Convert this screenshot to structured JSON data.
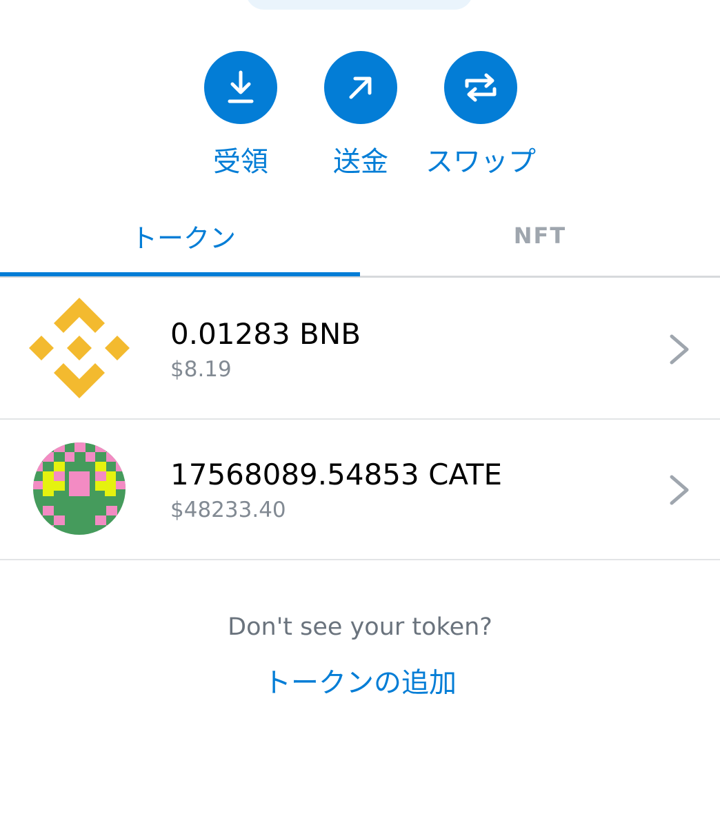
{
  "actions": {
    "receive_label": "受領",
    "send_label": "送金",
    "swap_label": "スワップ"
  },
  "tabs": {
    "tokens_label": "トークン",
    "nft_label": "NFT",
    "active": "tokens"
  },
  "tokens": [
    {
      "amount": "0.01283 BNB",
      "fiat": "$8.19",
      "icon": "bnb-logo"
    },
    {
      "amount": "17568089.54853 CATE",
      "fiat": "$48233.40",
      "icon": "cate-pixel-logo"
    }
  ],
  "footer": {
    "missing_text": "Don't see your token?",
    "add_link": "トークンの追加"
  },
  "colors": {
    "accent": "#037dd6",
    "bnb": "#f3ba2f",
    "cate_green": "#459b5c",
    "cate_pink": "#f38bc3",
    "cate_yellow": "#e5f20f"
  }
}
